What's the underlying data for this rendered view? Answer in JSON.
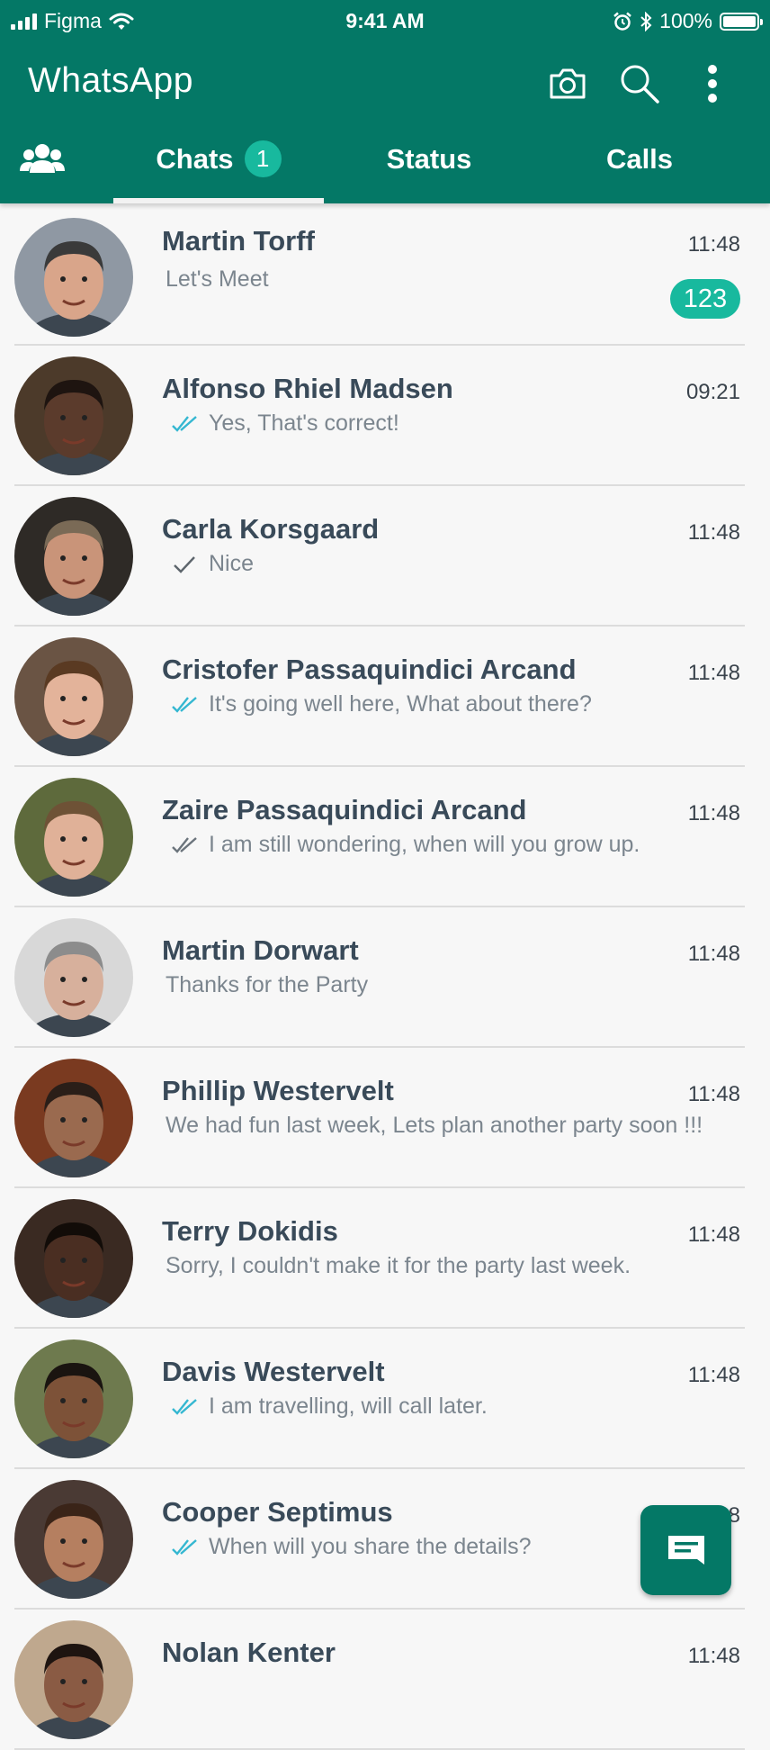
{
  "status_bar": {
    "carrier": "Figma",
    "time": "9:41 AM",
    "battery": "100%",
    "icons": [
      "signal-icon",
      "wifi-icon",
      "alarm-icon",
      "bluetooth-icon",
      "battery-icon"
    ]
  },
  "app_bar": {
    "title": "WhatsApp",
    "icons": [
      "camera-icon",
      "search-icon",
      "more-options-icon"
    ]
  },
  "tabs": {
    "contacts_icon": "contacts-icon",
    "items": [
      {
        "label": "Chats",
        "badge": "1",
        "selected": true
      },
      {
        "label": "Status"
      },
      {
        "label": "Calls"
      }
    ]
  },
  "colors": {
    "primary": "#047866",
    "accent": "#18b99e",
    "read_tick": "#34b7d1"
  },
  "chats": [
    {
      "name": "Martin Torff",
      "time": "11:48",
      "message": "Let's Meet",
      "tick": "none",
      "unread": "123"
    },
    {
      "name": "Alfonso Rhiel Madsen",
      "time": "09:21",
      "message": "Yes, That's correct!",
      "tick": "read"
    },
    {
      "name": "Carla Korsgaard",
      "time": "11:48",
      "message": "Nice",
      "tick": "sent"
    },
    {
      "name": "Cristofer Passaquindici Arcand",
      "time": "11:48",
      "message": "It's going well here, What about there?",
      "tick": "read"
    },
    {
      "name": "Zaire Passaquindici Arcand",
      "time": "11:48",
      "message": "I am still wondering, when will you grow up.",
      "tick": "delivered"
    },
    {
      "name": "Martin Dorwart",
      "time": "11:48",
      "message": "Thanks for the Party",
      "tick": "none"
    },
    {
      "name": "Phillip Westervelt",
      "time": "11:48",
      "message": "We had fun last week, Lets plan another party soon !!!",
      "tick": "none"
    },
    {
      "name": "Terry Dokidis",
      "time": "11:48",
      "message": "Sorry, I couldn't make it for the party last week.",
      "tick": "none"
    },
    {
      "name": "Davis Westervelt",
      "time": "11:48",
      "message": "I am travelling, will call later.",
      "tick": "read"
    },
    {
      "name": "Cooper Septimus",
      "time": "11:48",
      "message": "When will you share the details?",
      "tick": "read"
    },
    {
      "name": "Nolan Kenter",
      "time": "11:48",
      "message": "",
      "tick": "none"
    }
  ],
  "fab": {
    "icon": "new-message-icon"
  }
}
